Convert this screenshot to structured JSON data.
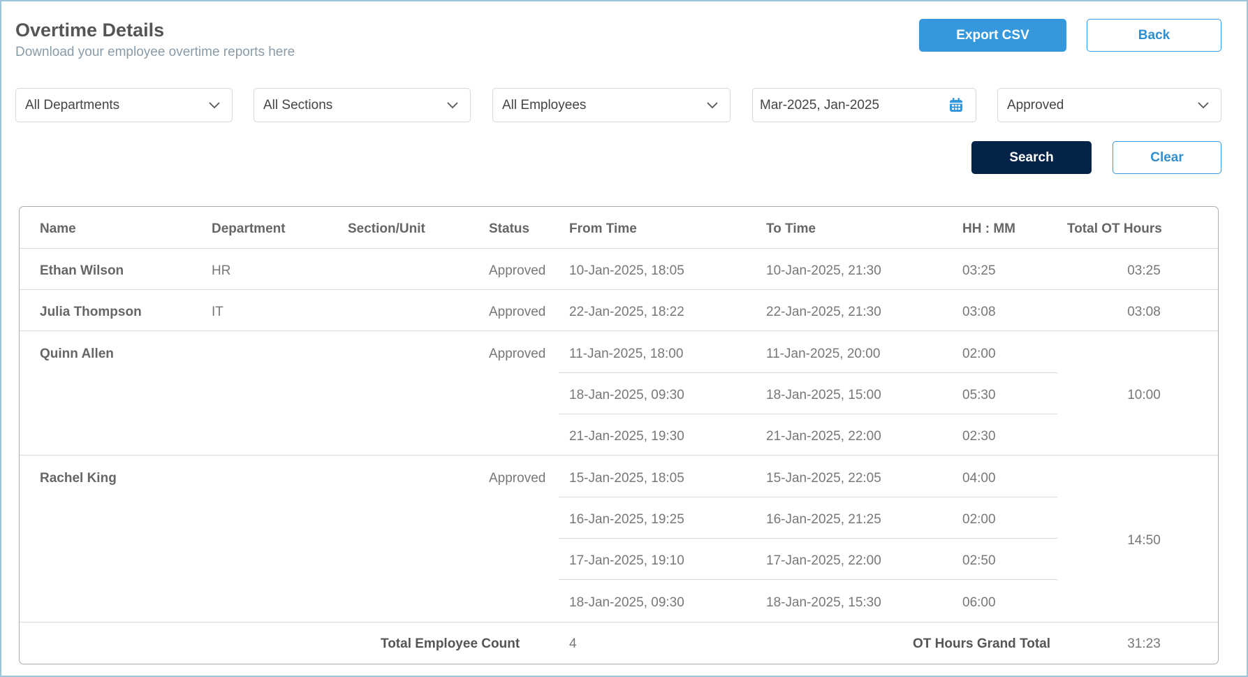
{
  "header": {
    "title": "Overtime Details",
    "subtitle": "Download your employee overtime reports here",
    "export_label": "Export CSV",
    "back_label": "Back"
  },
  "filters": {
    "department": "All Departments",
    "section": "All Sections",
    "employee": "All Employees",
    "date_range": "Mar-2025, Jan-2025",
    "status": "Approved",
    "search_label": "Search",
    "clear_label": "Clear"
  },
  "colors": {
    "primary": "#3598dc",
    "dark": "#032448",
    "border": "#9cc4dd"
  },
  "table": {
    "columns": [
      "Name",
      "Department",
      "Section/Unit",
      "Status",
      "From Time",
      "To Time",
      "HH : MM",
      "Total OT Hours"
    ],
    "employees": [
      {
        "name": "Ethan Wilson",
        "department": "HR",
        "section": "",
        "status": "Approved",
        "entries": [
          {
            "from": "10-Jan-2025, 18:05",
            "to": "10-Jan-2025, 21:30",
            "hhmm": "03:25"
          }
        ],
        "total": "03:25"
      },
      {
        "name": "Julia Thompson",
        "department": "IT",
        "section": "",
        "status": "Approved",
        "entries": [
          {
            "from": "22-Jan-2025, 18:22",
            "to": "22-Jan-2025, 21:30",
            "hhmm": "03:08"
          }
        ],
        "total": "03:08"
      },
      {
        "name": "Quinn Allen",
        "department": "",
        "section": "",
        "status": "Approved",
        "entries": [
          {
            "from": "11-Jan-2025, 18:00",
            "to": "11-Jan-2025, 20:00",
            "hhmm": "02:00"
          },
          {
            "from": "18-Jan-2025, 09:30",
            "to": "18-Jan-2025, 15:00",
            "hhmm": "05:30"
          },
          {
            "from": "21-Jan-2025, 19:30",
            "to": "21-Jan-2025, 22:00",
            "hhmm": "02:30"
          }
        ],
        "total": "10:00"
      },
      {
        "name": "Rachel King",
        "department": "",
        "section": "",
        "status": "Approved",
        "entries": [
          {
            "from": "15-Jan-2025, 18:05",
            "to": "15-Jan-2025, 22:05",
            "hhmm": "04:00"
          },
          {
            "from": "16-Jan-2025, 19:25",
            "to": "16-Jan-2025, 21:25",
            "hhmm": "02:00"
          },
          {
            "from": "17-Jan-2025, 19:10",
            "to": "17-Jan-2025, 22:00",
            "hhmm": "02:50"
          },
          {
            "from": "18-Jan-2025, 09:30",
            "to": "18-Jan-2025, 15:30",
            "hhmm": "06:00"
          }
        ],
        "total": "14:50"
      }
    ],
    "footer": {
      "count_label": "Total Employee Count",
      "count_value": "4",
      "grand_label": "OT Hours Grand Total",
      "grand_value": "31:23"
    }
  }
}
